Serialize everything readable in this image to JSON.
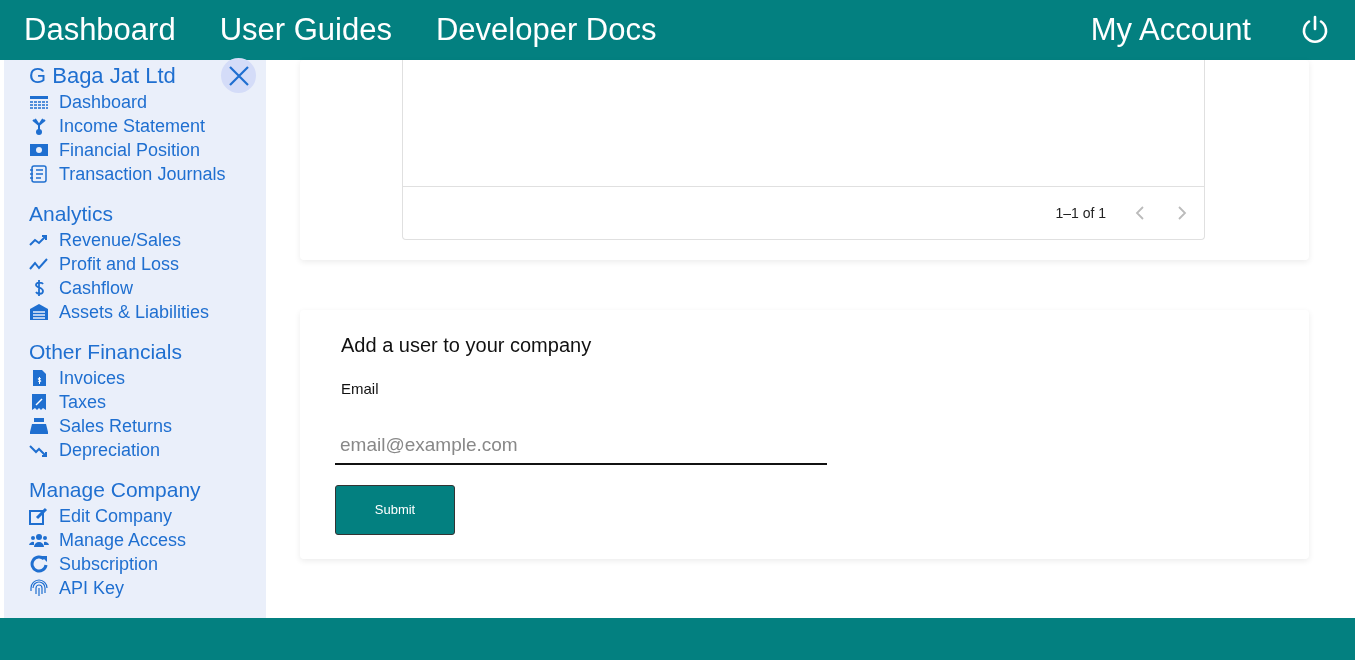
{
  "navbar": {
    "links": [
      "Dashboard",
      "User Guides",
      "Developer Docs"
    ],
    "account": "My Account"
  },
  "sidebar": {
    "title": "G Baga Jat Ltd",
    "sections": [
      {
        "items": [
          "Dashboard",
          "Income Statement",
          "Financial Position",
          "Transaction Journals"
        ]
      },
      {
        "heading": "Analytics",
        "items": [
          "Revenue/Sales",
          "Profit and Loss",
          "Cashflow",
          "Assets & Liabilities"
        ]
      },
      {
        "heading": "Other Financials",
        "items": [
          "Invoices",
          "Taxes",
          "Sales Returns",
          "Depreciation"
        ]
      },
      {
        "heading": "Manage Company",
        "items": [
          "Edit Company",
          "Manage Access",
          "Subscription",
          "API Key"
        ]
      }
    ]
  },
  "table_card": {
    "pagination": {
      "range": "1–1 of 1",
      "prev_disabled": true,
      "next_disabled": true
    }
  },
  "add_user": {
    "title": "Add a user to your company",
    "label": "Email",
    "placeholder": "email@example.com",
    "submit": "Submit"
  }
}
